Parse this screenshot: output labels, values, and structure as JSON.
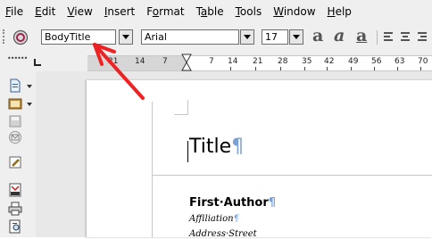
{
  "menubar": {
    "items": [
      {
        "u": "F",
        "rest": "ile"
      },
      {
        "u": "E",
        "rest": "dit"
      },
      {
        "u": "V",
        "rest": "iew"
      },
      {
        "u": "I",
        "rest": "nsert"
      },
      {
        "pre": "F",
        "u": "o",
        "rest": "rmat"
      },
      {
        "pre": "T",
        "u": "a",
        "rest": "ble"
      },
      {
        "u": "T",
        "rest": "ools"
      },
      {
        "u": "W",
        "rest": "indow"
      },
      {
        "u": "H",
        "rest": "elp"
      }
    ]
  },
  "toolbar": {
    "paragraph_style": "BodyTitle",
    "font_name": "Arial",
    "font_size": "17",
    "icons": [
      "styles-icon",
      "bold-icon",
      "italic-icon",
      "underline-icon",
      "align-left-icon",
      "align-center-icon",
      "align-right-icon"
    ]
  },
  "ruler": {
    "labels": [
      "21",
      "14",
      "7",
      "7",
      "14",
      "21",
      "28",
      "35",
      "42",
      "49",
      "56",
      "63",
      "70"
    ]
  },
  "sidebar": {
    "icons": [
      "new-document-icon",
      "templates-icon",
      "save-icon",
      "email-icon",
      "edit-icon",
      "export-pdf-icon",
      "print-icon",
      "print-preview-icon"
    ]
  },
  "document": {
    "title": "Title",
    "pilcrow": "¶",
    "author": "First·Author",
    "affiliation": "Affiliation",
    "address": "Address·Street"
  },
  "colors": {
    "annotation_arrow": "#ee2222",
    "formatting_marks": "#7ba1d4"
  }
}
